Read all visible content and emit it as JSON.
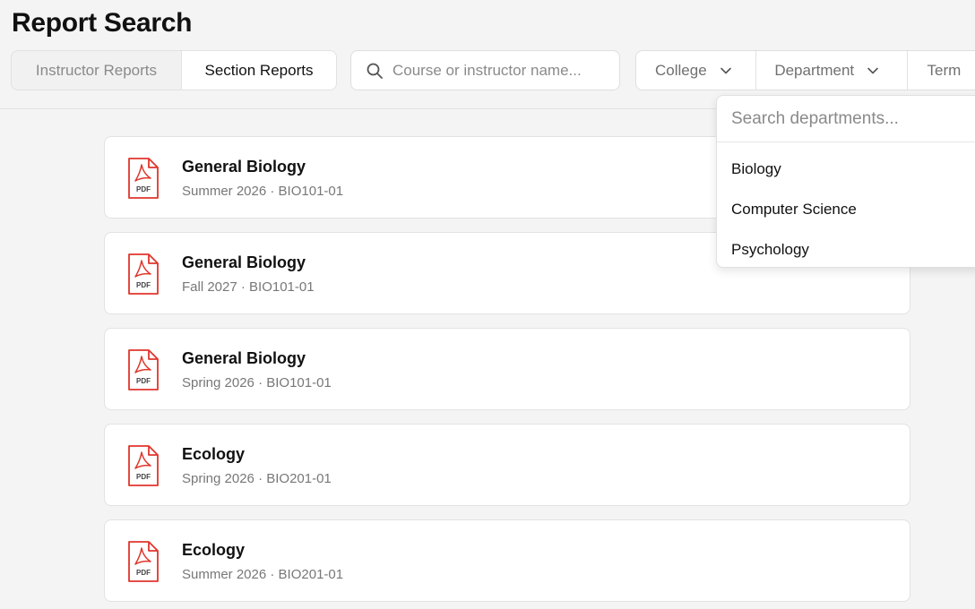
{
  "page": {
    "title": "Report Search"
  },
  "tabs": [
    {
      "label": "Instructor Reports",
      "active": false
    },
    {
      "label": "Section Reports",
      "active": true
    }
  ],
  "search": {
    "placeholder": "Course or instructor name...",
    "value": "",
    "icon": "search-icon"
  },
  "filters": [
    {
      "label": "College",
      "icon": "chevron-down-icon"
    },
    {
      "label": "Department",
      "icon": "chevron-down-icon"
    },
    {
      "label": "Term"
    }
  ],
  "dropdown": {
    "placeholder": "Search departments...",
    "options": [
      "Biology",
      "Computer Science",
      "Psychology"
    ]
  },
  "results": [
    {
      "title": "General Biology",
      "subtitle": "Summer 2026 · BIO101-01",
      "icon": "pdf-icon"
    },
    {
      "title": "General Biology",
      "subtitle": "Fall 2027 · BIO101-01",
      "icon": "pdf-icon"
    },
    {
      "title": "General Biology",
      "subtitle": "Spring 2026 · BIO101-01",
      "icon": "pdf-icon"
    },
    {
      "title": "Ecology",
      "subtitle": "Spring 2026 · BIO201-01",
      "icon": "pdf-icon"
    },
    {
      "title": "Ecology",
      "subtitle": "Summer 2026 · BIO201-01",
      "icon": "pdf-icon"
    }
  ],
  "colors": {
    "pdf_red": "#e0362c",
    "background": "#f4f4f4",
    "card": "#ffffff"
  }
}
